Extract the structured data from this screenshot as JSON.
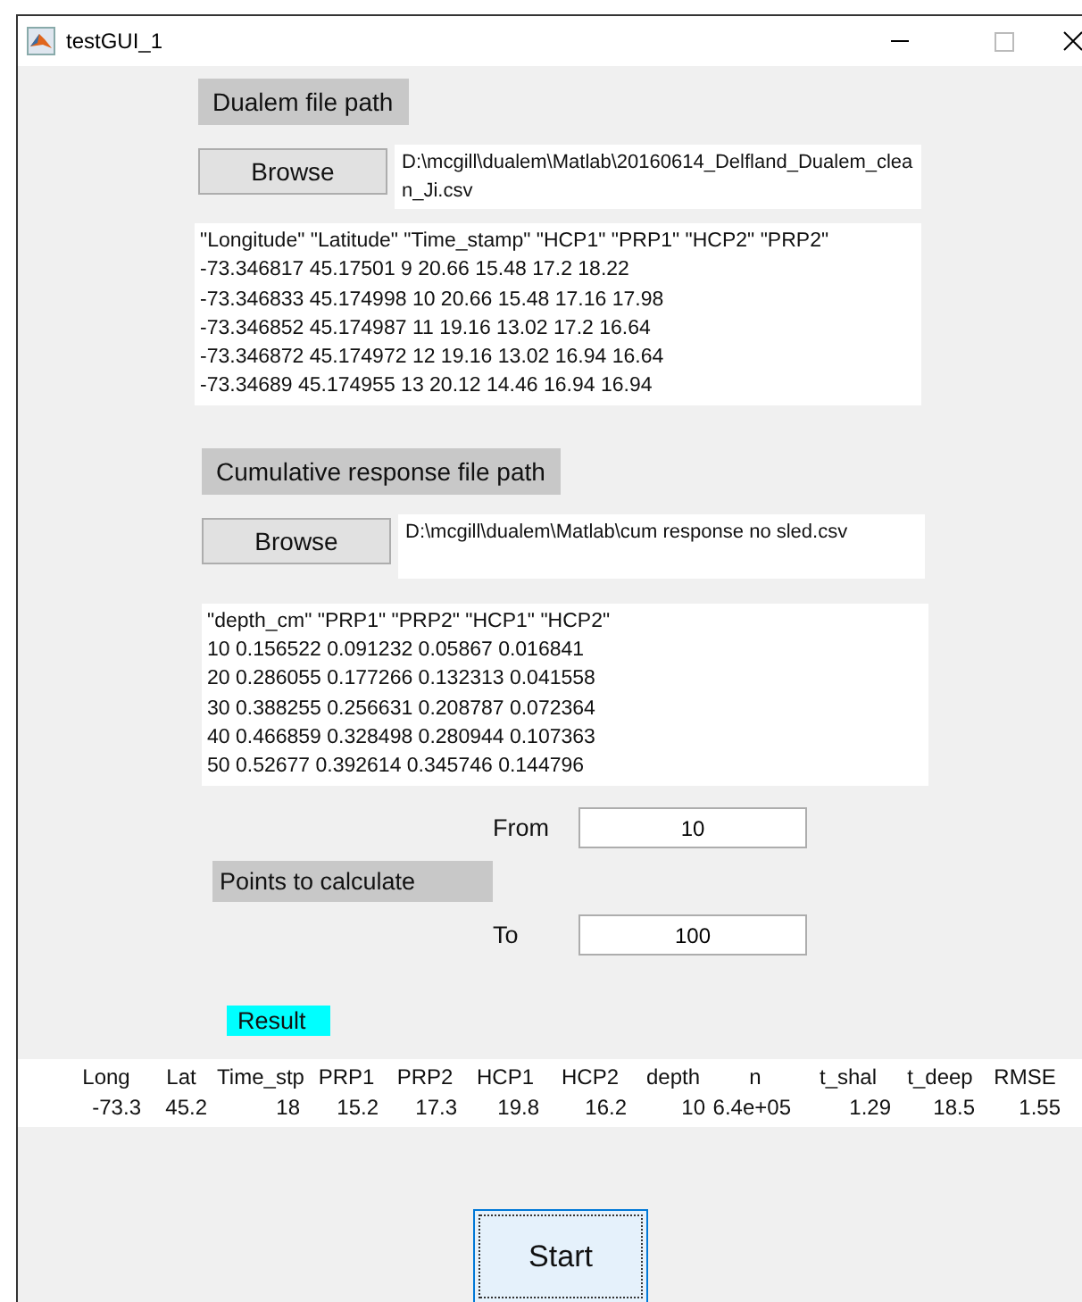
{
  "window": {
    "title": "testGUI_1"
  },
  "dualem": {
    "label": "Dualem file path",
    "browse": "Browse",
    "path": "D:\\mcgill\\dualem\\Matlab\\20160614_Delfland_Dualem_clean_Ji.csv",
    "preview": [
      "\"Longitude\" \"Latitude\" \"Time_stamp\" \"HCP1\" \"PRP1\" \"HCP2\" \"PRP2\"",
      "-73.346817 45.17501 9 20.66 15.48 17.2 18.22",
      "-73.346833 45.174998 10 20.66 15.48 17.16 17.98",
      "-73.346852 45.174987 11 19.16 13.02 17.2 16.64",
      "-73.346872 45.174972 12 19.16 13.02 16.94 16.64",
      "-73.34689 45.174955 13 20.12 14.46 16.94 16.94"
    ]
  },
  "cumulative": {
    "label": "Cumulative response file path",
    "browse": "Browse",
    "path": "D:\\mcgill\\dualem\\Matlab\\cum response no sled.csv",
    "preview": [
      "\"depth_cm\" \"PRP1\" \"PRP2\" \"HCP1\" \"HCP2\"",
      "10 0.156522 0.091232 0.05867 0.016841",
      "20 0.286055 0.177266 0.132313 0.041558",
      "30 0.388255 0.256631 0.208787 0.072364",
      "40 0.466859 0.328498 0.280944 0.107363",
      "50 0.52677 0.392614 0.345746 0.144796"
    ]
  },
  "points": {
    "label": "Points to calculate",
    "from": {
      "label": "From",
      "value": "10"
    },
    "to": {
      "label": "To",
      "value": "100"
    }
  },
  "result": {
    "label": "Result",
    "color": "#00ffff"
  },
  "results_table": {
    "columns": [
      "Long",
      "Lat",
      "Time_stp",
      "PRP1",
      "PRP2",
      "HCP1",
      "HCP2",
      "depth",
      "n",
      "t_shal",
      "t_deep",
      "RMSE"
    ],
    "values": [
      "-73.3",
      "45.2",
      "18",
      "15.2",
      "17.3",
      "19.8",
      "16.2",
      "10",
      "6.4e+05",
      "1.29",
      "18.5",
      "1.55"
    ]
  },
  "start": {
    "label": "Start",
    "focused": true
  }
}
